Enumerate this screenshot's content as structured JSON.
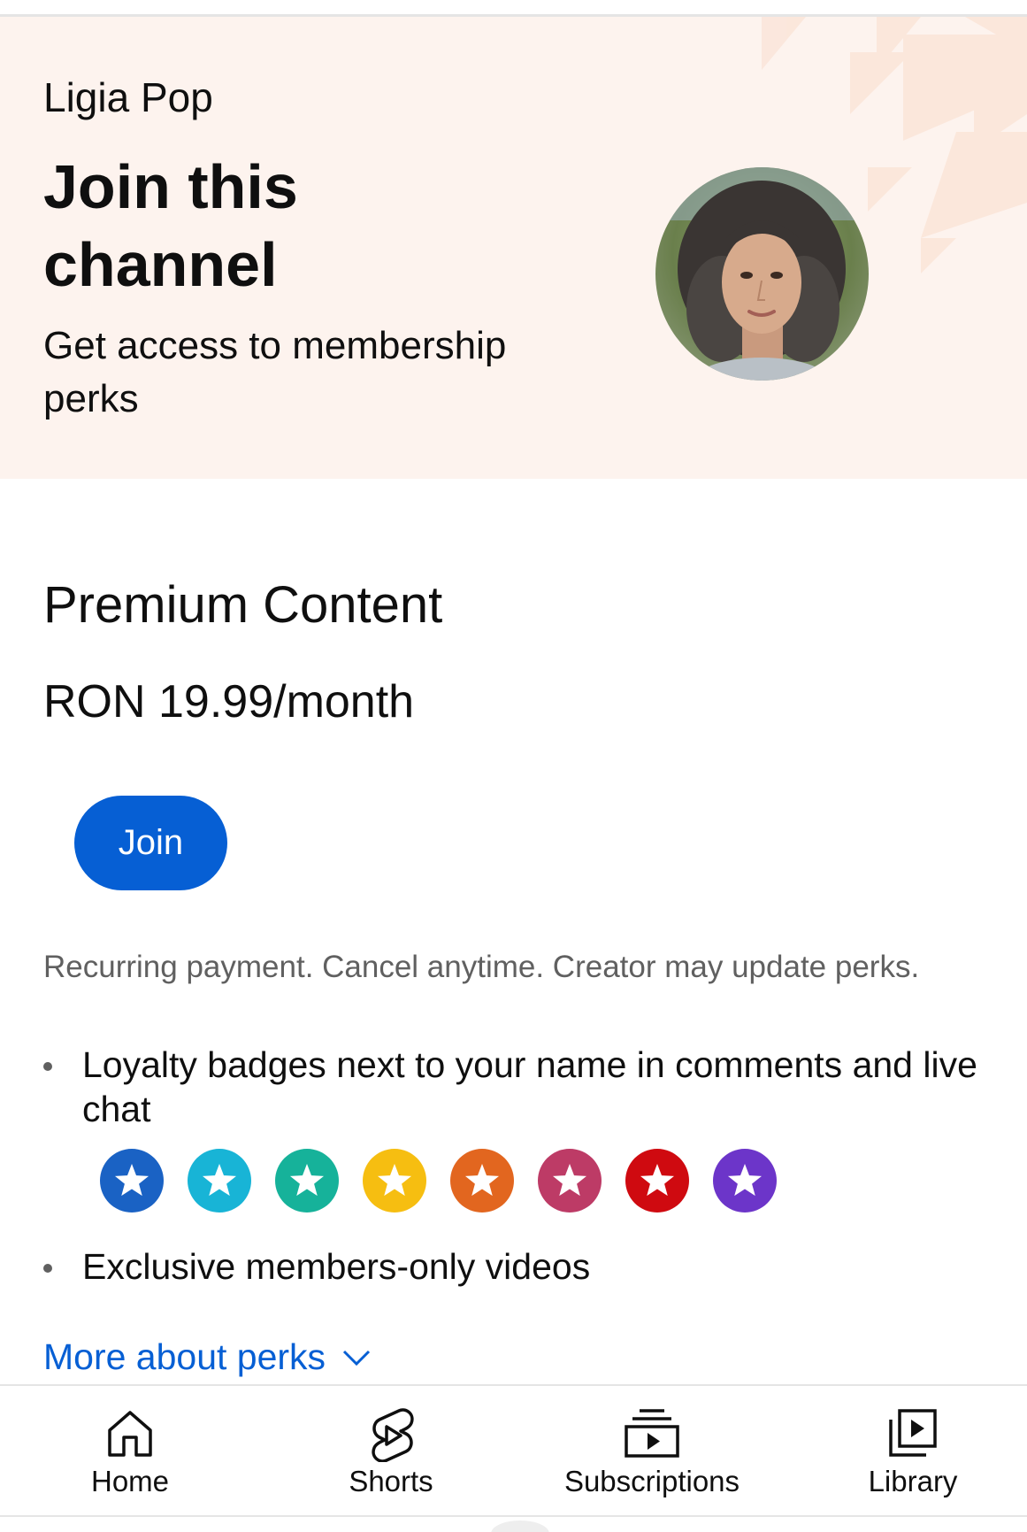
{
  "header": {
    "channel_name": "Ligia Pop",
    "title": "Join this channel",
    "subtitle": "Get access to membership perks",
    "avatar": "creator-avatar"
  },
  "tier": {
    "name": "Premium Content",
    "price": "RON 19.99/month",
    "join_label": "Join",
    "fine_print": "Recurring payment. Cancel anytime. Creator may update perks."
  },
  "perks": [
    {
      "text": "Loyalty badges next to your name in comments and live chat"
    },
    {
      "text": "Exclusive members-only videos"
    }
  ],
  "badges": [
    {
      "icon": "star-badge-icon",
      "color": "#1a62c4"
    },
    {
      "icon": "star-badge-icon",
      "color": "#18b4d6"
    },
    {
      "icon": "star-badge-icon",
      "color": "#16b29a"
    },
    {
      "icon": "star-badge-icon",
      "color": "#f6be11"
    },
    {
      "icon": "star-badge-icon",
      "color": "#e2661f"
    },
    {
      "icon": "star-badge-icon",
      "color": "#bd3b66"
    },
    {
      "icon": "star-badge-icon",
      "color": "#cf0a10"
    },
    {
      "icon": "star-badge-icon",
      "color": "#6c35c9"
    }
  ],
  "more_perks_label": "More about perks",
  "colors": {
    "accent": "#065fd4",
    "hero_background": "#fdf3ee"
  },
  "nav": [
    {
      "label": "Home",
      "icon": "home-icon"
    },
    {
      "label": "Shorts",
      "icon": "shorts-icon"
    },
    {
      "label": "Subscriptions",
      "icon": "subscriptions-icon"
    },
    {
      "label": "Library",
      "icon": "library-icon"
    }
  ]
}
